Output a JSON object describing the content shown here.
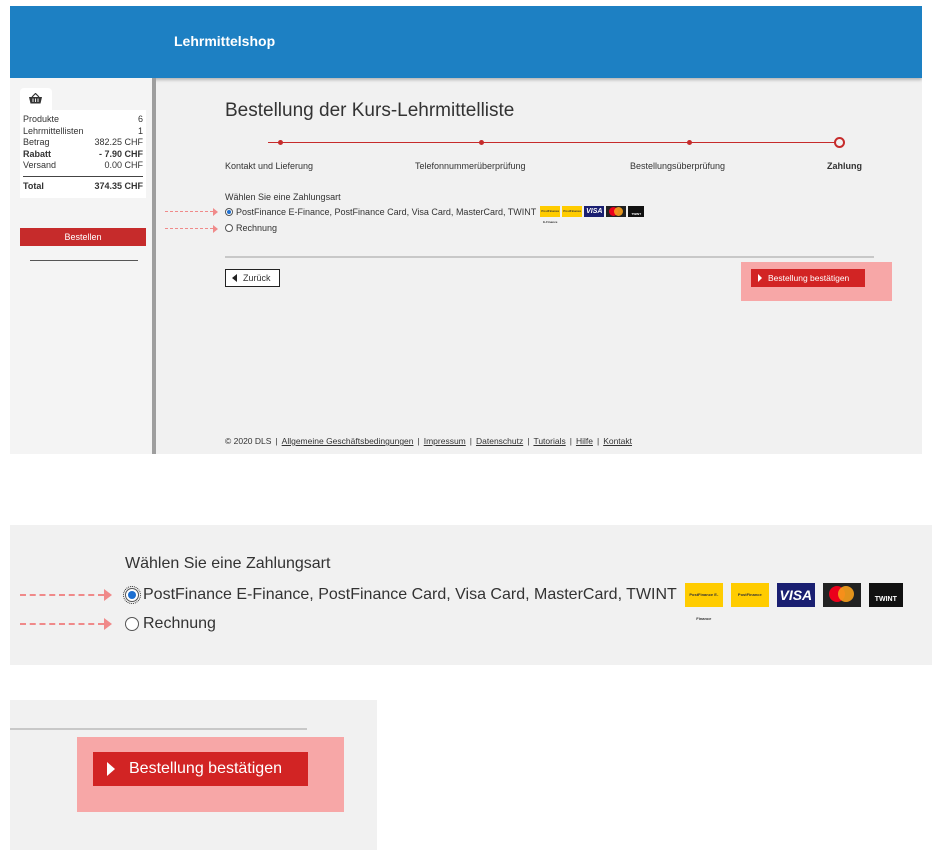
{
  "header": {
    "title": "Lehrmittelshop"
  },
  "sidebar": {
    "cart_icon": "basket-icon",
    "rows": [
      {
        "label": "Produkte",
        "value": "6",
        "bold": false
      },
      {
        "label": "Lehrmittellisten",
        "value": "1",
        "bold": false
      },
      {
        "label": "Betrag",
        "value": "382.25 CHF",
        "bold": false
      },
      {
        "label": "Rabatt",
        "value": "- 7.90 CHF",
        "bold": true
      },
      {
        "label": "Versand",
        "value": "0.00 CHF",
        "bold": false
      }
    ],
    "total_label": "Total",
    "total_value": "374.35 CHF",
    "order_button": "Bestellen"
  },
  "main": {
    "title": "Bestellung der Kurs-Lehrmittelliste",
    "steps": [
      {
        "label": "Kontakt und Lieferung"
      },
      {
        "label": "Telefonnummerüberprüfung"
      },
      {
        "label": "Bestellungsüberprüfung"
      },
      {
        "label": "Zahlung",
        "active": true
      }
    ],
    "payment": {
      "heading": "Wählen Sie eine Zahlungsart",
      "options": [
        {
          "label": "PostFinance E-Finance, PostFinance Card, Visa Card, MasterCard, TWINT",
          "checked": true
        },
        {
          "label": "Rechnung",
          "checked": false
        }
      ],
      "logos": {
        "postfinance_efinance": "PostFinance E-Finance",
        "postfinance_card": "PostFinance",
        "visa": "VISA",
        "mastercard": "mastercard",
        "twint": "TWINT"
      }
    },
    "back_button": "Zurück",
    "confirm_button": "Bestellung bestätigen"
  },
  "footer": {
    "copyright": "© 2020 DLS",
    "links": [
      "Allgemeine Geschäftsbedingungen",
      "Impressum",
      "Datenschutz",
      "Tutorials",
      "Hilfe",
      "Kontakt"
    ]
  },
  "colors": {
    "header_blue": "#1d80c3",
    "accent_red": "#c62b2b",
    "highlight_pink": "#f7a7a7",
    "annotation_arrow": "#f08a8a",
    "radio_blue": "#1d6fd1"
  }
}
